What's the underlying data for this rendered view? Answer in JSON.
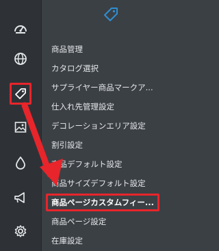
{
  "rail": {
    "icons": [
      "dashboard-icon",
      "globe-icon",
      "tag-icon",
      "image-icon",
      "droplet-icon",
      "megaphone-icon",
      "gear-icon"
    ],
    "active": "tag-icon"
  },
  "panel": {
    "header_icon": "tag-icon",
    "items": [
      {
        "label": "商品管理"
      },
      {
        "label": "カタログ選択"
      },
      {
        "label": "サプライヤー商品マークア..."
      },
      {
        "label": "仕入れ先管理設定"
      },
      {
        "label": "デコレーションエリア設定"
      },
      {
        "label": "割引設定"
      },
      {
        "label": "商品デフォルト設定"
      },
      {
        "label": "商品サイズデフォルト設定"
      },
      {
        "label": "商品ページカスタムフィー..."
      },
      {
        "label": "商品ページ設定"
      },
      {
        "label": "在庫設定"
      }
    ],
    "selected_index": 8
  },
  "colors": {
    "rail_bg": "#2e3237",
    "panel_bg": "#3b4045",
    "accent": "#2f8fd3",
    "highlight": "#e8252b",
    "text": "#e6e8ea"
  }
}
